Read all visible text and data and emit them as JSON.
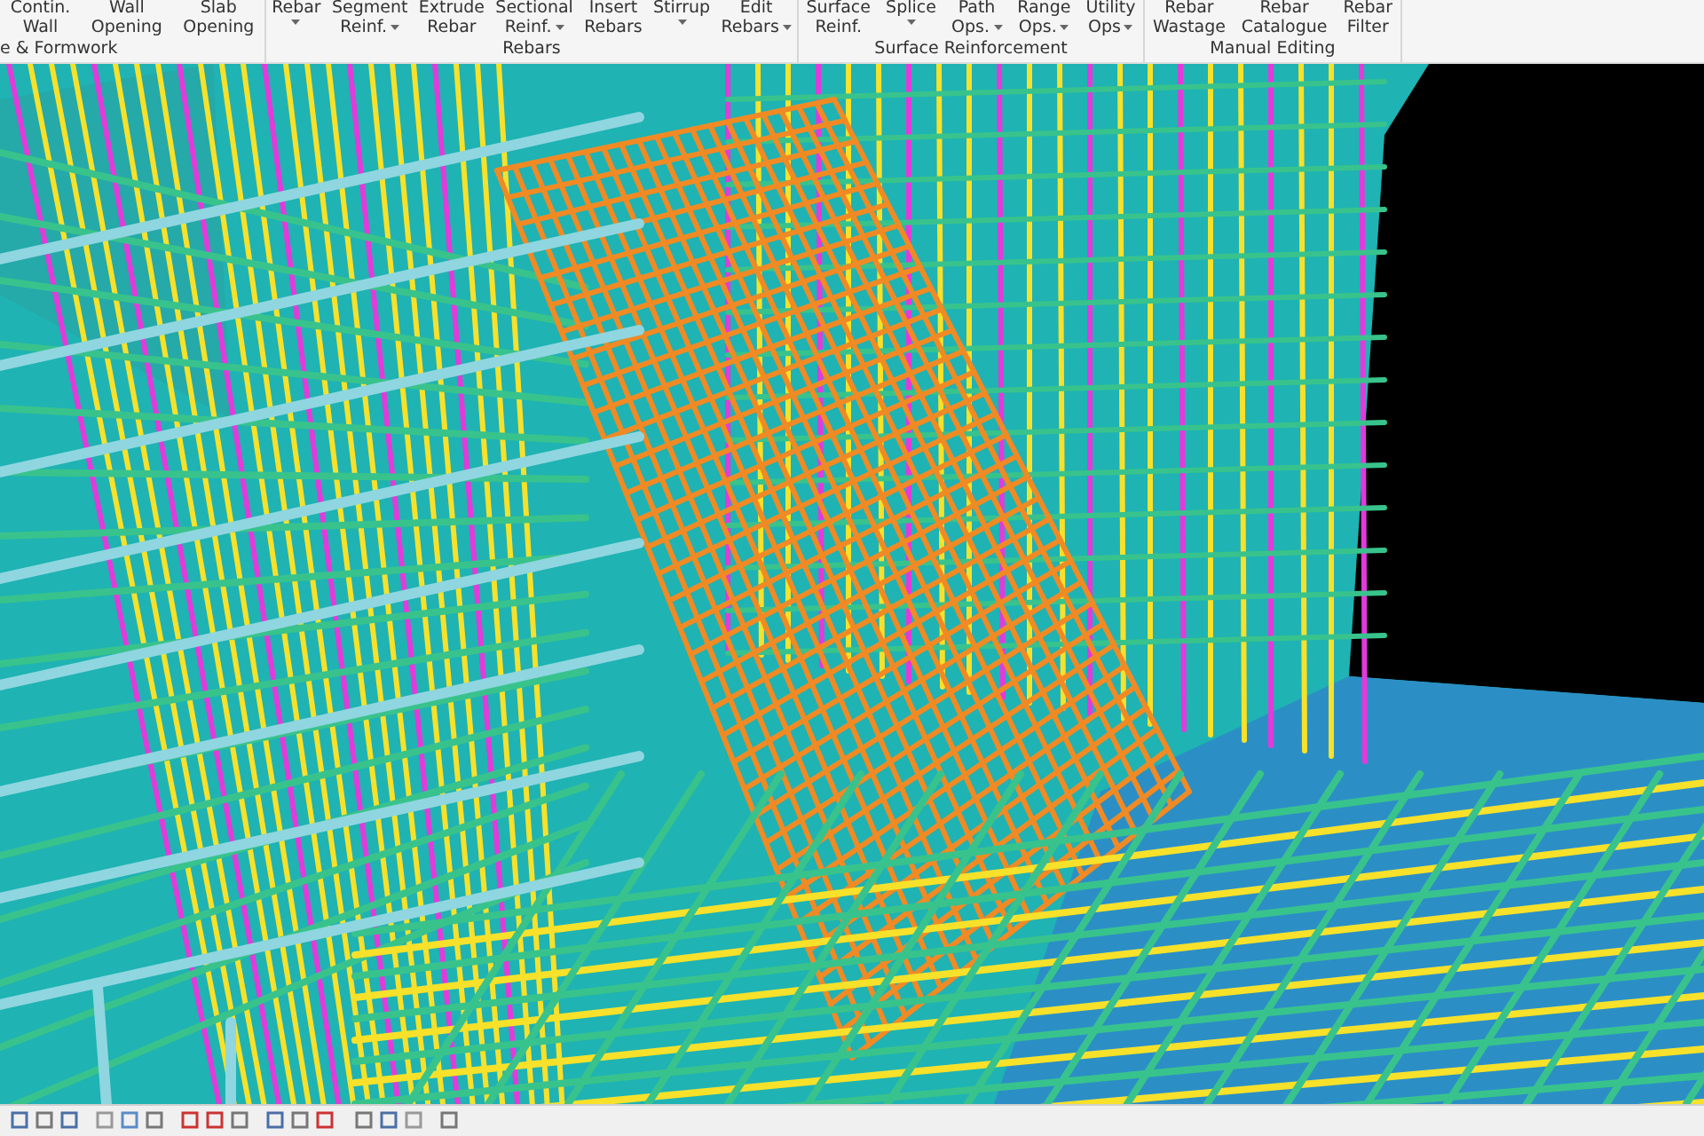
{
  "ribbon": {
    "groups": [
      {
        "label": "e & Formwork",
        "buttons": [
          {
            "lines": [
              "Contin.",
              "Wall"
            ],
            "menu": false
          },
          {
            "lines": [
              "Wall",
              "Opening"
            ],
            "menu": false
          },
          {
            "lines": [
              "Slab",
              "Opening"
            ],
            "menu": false
          }
        ]
      },
      {
        "label": "Rebars",
        "buttons": [
          {
            "lines": [
              "Rebar"
            ],
            "menu": true
          },
          {
            "lines": [
              "Segment",
              "Reinf."
            ],
            "menu": true
          },
          {
            "lines": [
              "Extrude",
              "Rebar"
            ],
            "menu": false
          },
          {
            "lines": [
              "Sectional",
              "Reinf."
            ],
            "menu": true
          },
          {
            "lines": [
              "Insert",
              "Rebars"
            ],
            "menu": false
          },
          {
            "lines": [
              "Stirrup"
            ],
            "menu": true
          },
          {
            "lines": [
              "Edit",
              "Rebars"
            ],
            "menu": true
          }
        ]
      },
      {
        "label": "Surface Reinforcement",
        "buttons": [
          {
            "lines": [
              "Surface",
              "Reinf."
            ],
            "menu": false
          },
          {
            "lines": [
              "Splice"
            ],
            "menu": true
          },
          {
            "lines": [
              "Path",
              "Ops."
            ],
            "menu": true
          },
          {
            "lines": [
              "Range",
              "Ops."
            ],
            "menu": true
          },
          {
            "lines": [
              "Utility",
              "Ops"
            ],
            "menu": true
          }
        ]
      },
      {
        "label": "Manual Editing",
        "buttons": [
          {
            "lines": [
              "Rebar",
              "Wastage"
            ],
            "menu": false
          },
          {
            "lines": [
              "Rebar",
              "Catalogue"
            ],
            "menu": false
          },
          {
            "lines": [
              "Rebar",
              "Filter"
            ],
            "menu": false
          }
        ]
      }
    ]
  }
}
